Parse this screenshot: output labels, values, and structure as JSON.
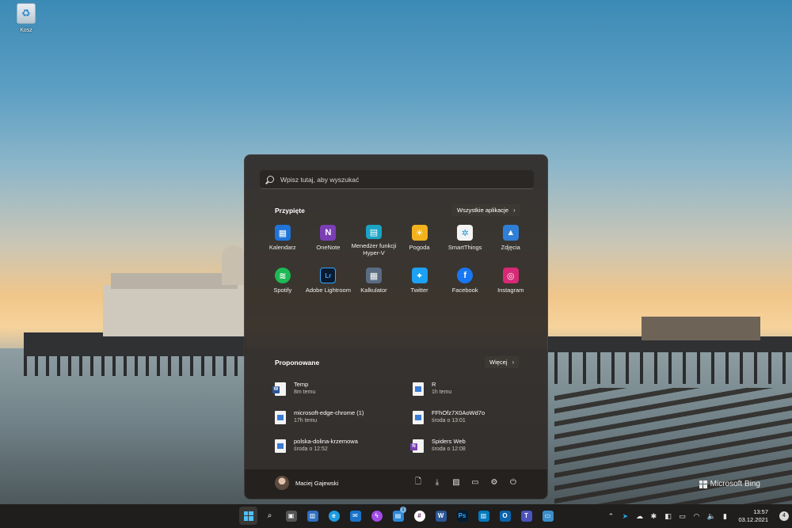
{
  "desktop": {
    "recycle_bin_label": "Kosz",
    "watermark": "Microsoft Bing"
  },
  "start_menu": {
    "search_placeholder": "Wpisz tutaj, aby wyszukać",
    "pinned": {
      "title": "Przypięte",
      "all_apps_label": "Wszystkie aplikacje",
      "apps": [
        {
          "label": "Kalendarz",
          "icon": "calendar-icon",
          "color": "#1e74d8",
          "glyph": "▦"
        },
        {
          "label": "OneNote",
          "icon": "onenote-icon",
          "color": "#7b3fb5",
          "glyph": "N"
        },
        {
          "label": "Menedżer funkcji Hyper-V",
          "icon": "hyperv-icon",
          "color": "#1aa3c5",
          "glyph": "▤"
        },
        {
          "label": "Pogoda",
          "icon": "weather-icon",
          "color": "#f2b21d",
          "glyph": "☀"
        },
        {
          "label": "SmartThings",
          "icon": "smartthings-icon",
          "color": "#f3f3f3",
          "glyph": "✲"
        },
        {
          "label": "Zdjęcia",
          "icon": "photos-icon",
          "color": "#2f7fd6",
          "glyph": "▲"
        },
        {
          "label": "Spotify",
          "icon": "spotify-icon",
          "color": "#1db954",
          "glyph": "≋"
        },
        {
          "label": "Adobe Lightroom",
          "icon": "lightroom-icon",
          "color": "#0b1a2e",
          "glyph": "Lr"
        },
        {
          "label": "Kalkulator",
          "icon": "calculator-icon",
          "color": "#5a6c82",
          "glyph": "▦"
        },
        {
          "label": "Twitter",
          "icon": "twitter-icon",
          "color": "#1da1f2",
          "glyph": "✦"
        },
        {
          "label": "Facebook",
          "icon": "facebook-icon",
          "color": "#1877f2",
          "glyph": "f"
        },
        {
          "label": "Instagram",
          "icon": "instagram-icon",
          "color": "#d62976",
          "glyph": "◎"
        }
      ]
    },
    "recommended": {
      "title": "Proponowane",
      "more_label": "Więcej",
      "items": [
        {
          "name": "Temp",
          "time": "8m temu",
          "type": "word"
        },
        {
          "name": "R",
          "time": "1h temu",
          "type": "img"
        },
        {
          "name": "microsoft-edge-chrome (1)",
          "time": "17h temu",
          "type": "img"
        },
        {
          "name": "FFhOfz7X0AoWd7o",
          "time": "środa o 13:01",
          "type": "img"
        },
        {
          "name": "polska-dolina-krzemowa",
          "time": "środa o 12:52",
          "type": "img"
        },
        {
          "name": "Spiders Web",
          "time": "środa o 12:08",
          "type": "onenote"
        }
      ]
    },
    "user": {
      "name": "Maciej Gajewski"
    }
  },
  "taskbar": {
    "clock_time": "13:57",
    "clock_date": "03.12.2021",
    "notification_count": "4",
    "store_badge": "1"
  }
}
